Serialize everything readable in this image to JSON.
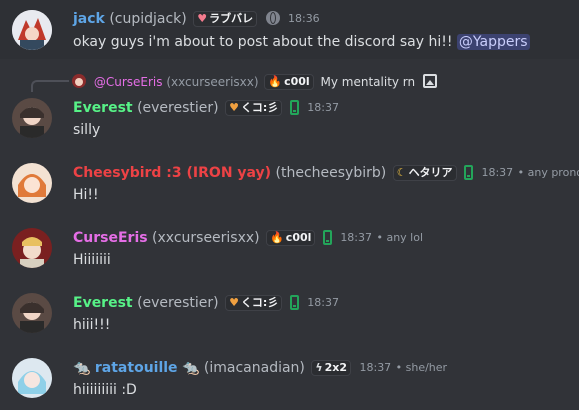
{
  "colors": {
    "background": "#313338",
    "highlight": "#2e3035",
    "jack": "#5ea5e6",
    "everest": "#57f287",
    "cheesybird": "#ed4245",
    "curseeris": "#e56ee6",
    "ratatouille": "#5ea5e6",
    "mention": "#c9cdfb"
  },
  "messages": [
    {
      "display_name": "jack",
      "username": "(cupidjack)",
      "tag_icon": "heart-icon",
      "tag": "ラブバレ",
      "status_icon": "globe-icon",
      "time": "18:36",
      "text": "okay guys i'm about to post about the discord say hi!!",
      "mention": "@Yappers"
    },
    {
      "reply": {
        "name": "@CurseEris",
        "username": "(xxcurseerisxx)",
        "tag": "c00l",
        "text": "My mentality rn",
        "attachment_icon": "image-icon"
      },
      "display_name": "Everest",
      "username": "(everestier)",
      "tag_icon": "heart-icon",
      "tag": "くコ:彡",
      "status_icon": "mobile-icon",
      "time": "18:37",
      "text": "silly"
    },
    {
      "display_name": "Cheesybird :3 (IRON yay)",
      "username": "(thecheesybirb)",
      "tag_icon": "moon-icon",
      "tag": "ヘタリア",
      "status_icon": "mobile-icon",
      "time": "18:37",
      "pronouns": "• any pronouns",
      "text": "Hi!!"
    },
    {
      "display_name": "CurseEris",
      "username": "(xxcurseerisxx)",
      "tag_icon": "flame-icon",
      "tag": "c00l",
      "status_icon": "mobile-icon",
      "time": "18:37",
      "pronouns": "• any lol",
      "text": "Hiiiiiii"
    },
    {
      "display_name": "Everest",
      "username": "(everestier)",
      "tag_icon": "heart-icon",
      "tag": "くコ:彡",
      "status_icon": "mobile-icon",
      "time": "18:37",
      "text": "hiii!!!"
    },
    {
      "display_name": "ratatouille",
      "name_emoji": "🐀",
      "username": "(imacanadian)",
      "tag_icon": "lightning-icon",
      "tag": "2x2",
      "time": "18:37",
      "pronouns": "• she/her",
      "text": "hiiiiiiiii :D"
    }
  ]
}
